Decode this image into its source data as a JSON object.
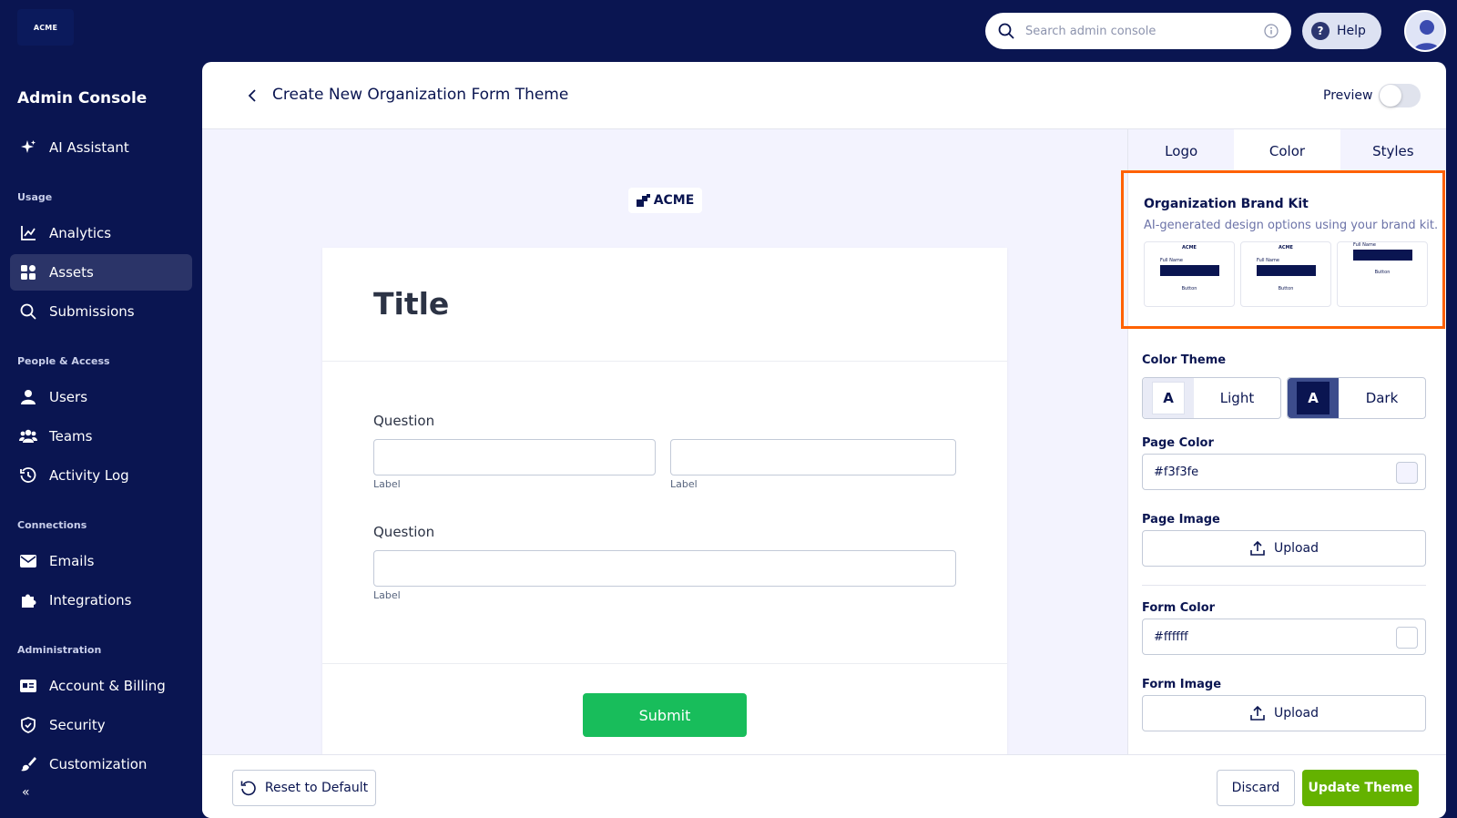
{
  "topbar": {
    "logo_text": "ACME",
    "search_placeholder": "Search admin console",
    "help_label": "Help"
  },
  "sidebar": {
    "title": "Admin Console",
    "items": [
      {
        "label": "AI Assistant",
        "icon": "sparkle-icon"
      },
      {
        "label": "Analytics",
        "icon": "chart-line-icon"
      },
      {
        "label": "Assets",
        "icon": "grid-icon",
        "active": true
      },
      {
        "label": "Submissions",
        "icon": "search-icon"
      },
      {
        "label": "Users",
        "icon": "user-icon"
      },
      {
        "label": "Teams",
        "icon": "team-icon"
      },
      {
        "label": "Activity Log",
        "icon": "history-icon"
      },
      {
        "label": "Emails",
        "icon": "mail-icon"
      },
      {
        "label": "Integrations",
        "icon": "puzzle-icon"
      },
      {
        "label": "Account & Billing",
        "icon": "id-card-icon"
      },
      {
        "label": "Security",
        "icon": "shield-icon"
      },
      {
        "label": "Customization",
        "icon": "brush-icon"
      }
    ],
    "sections": {
      "usage": "Usage",
      "people": "People & Access",
      "connections": "Connections",
      "administration": "Administration"
    }
  },
  "header": {
    "title": "Create New Organization Form Theme",
    "preview_label": "Preview"
  },
  "form_preview": {
    "logo_text": "ACME",
    "title": "Title",
    "question1": "Question",
    "question2": "Question",
    "label": "Label",
    "submit_label": "Submit"
  },
  "panel": {
    "tabs": [
      "Logo",
      "Color",
      "Styles"
    ],
    "active_tab": "Color",
    "brand_kit": {
      "title": "Organization Brand Kit",
      "subtitle": "AI-generated design options using your brand kit.",
      "thumb_logo": "ACME",
      "thumb_field": "Full Name",
      "thumb_button": "Button"
    },
    "color_theme_label": "Color Theme",
    "theme_light": "Light",
    "theme_dark": "Dark",
    "theme_swatch_letter": "A",
    "page_color_label": "Page Color",
    "page_color_value": "#f3f3fe",
    "page_image_label": "Page Image",
    "upload_label": "Upload",
    "form_color_label": "Form Color",
    "form_color_value": "#ffffff",
    "form_image_label": "Form Image"
  },
  "footer": {
    "reset_label": "Reset to Default",
    "discard_label": "Discard",
    "update_label": "Update Theme"
  },
  "colors": {
    "navy": "#0a1551",
    "submit_green": "#18bd5b",
    "update_green": "#64b200",
    "highlight": "#ff6100",
    "tab_accent": "#0075e3"
  }
}
